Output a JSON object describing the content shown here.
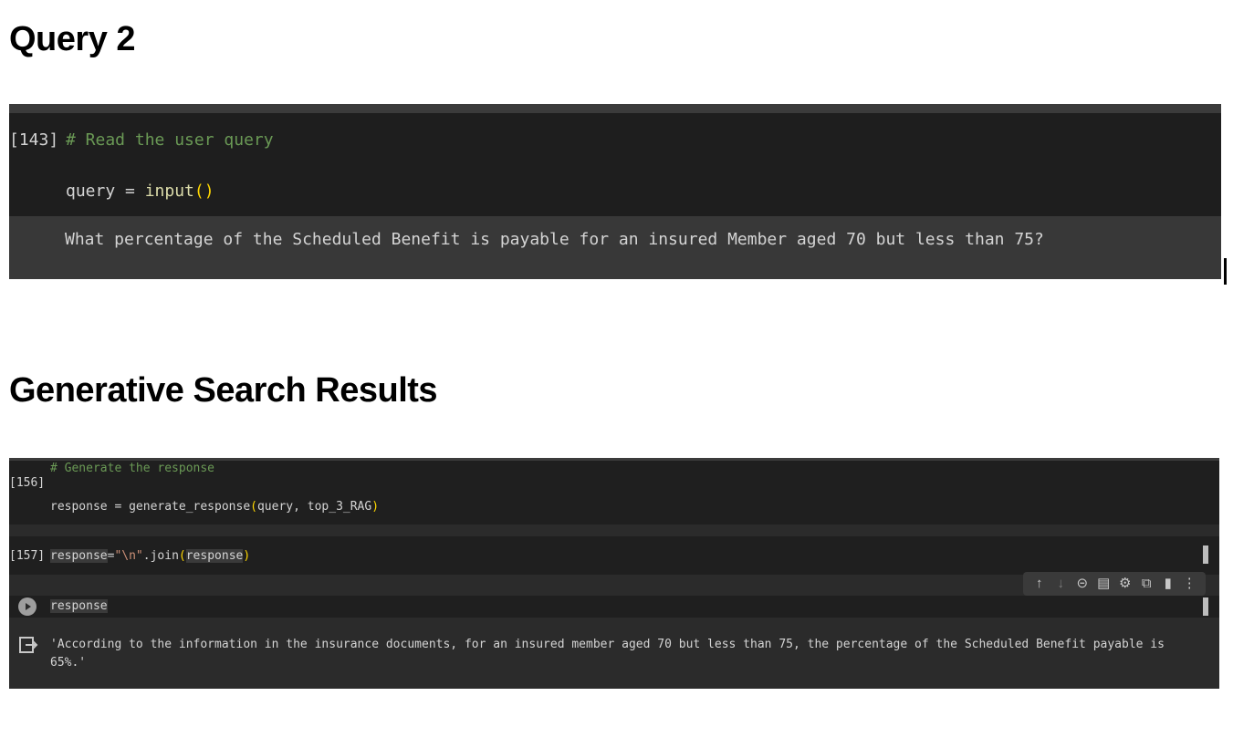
{
  "headings": {
    "query2": "Query 2",
    "generative": "Generative Search Results"
  },
  "cell_143": {
    "number": "[143]",
    "comment": "# Read the user query",
    "code_var": "query",
    "code_eq": " = ",
    "code_func": "input",
    "code_paren": "()",
    "output": "What percentage of the Scheduled Benefit is payable for an insured Member aged 70 but less than 75?"
  },
  "cell_156": {
    "number": "[156]",
    "comment": "# Generate the response",
    "code_prefix": "response = generate_response",
    "paren_open": "(",
    "args": "query, top_3_RAG",
    "paren_close": ")"
  },
  "cell_157": {
    "number": "[157]",
    "var": "response",
    "eq": "=",
    "string": "\"\\n\"",
    "method": ".join",
    "paren_open": "(",
    "arg": "response",
    "paren_close": ")"
  },
  "cell_run": {
    "code": "response",
    "output_line1": "'According to the information in the insurance documents, for an insured member aged 70 but less than 75, the percentage of the Scheduled Benefit payable is",
    "output_line2": "65%.'"
  },
  "toolbar_icons": [
    "arrow-up-icon",
    "arrow-down-icon",
    "link-icon",
    "comment-icon",
    "gear-icon",
    "mirror-cell-icon",
    "trash-icon",
    "more-vert-icon"
  ],
  "colors": {
    "comment": "#6a9955",
    "code": "#d4d4d4",
    "function": "#dcdcaa",
    "paren": "#ffd700",
    "string": "#ce9178",
    "output": "#d4d4d4"
  }
}
